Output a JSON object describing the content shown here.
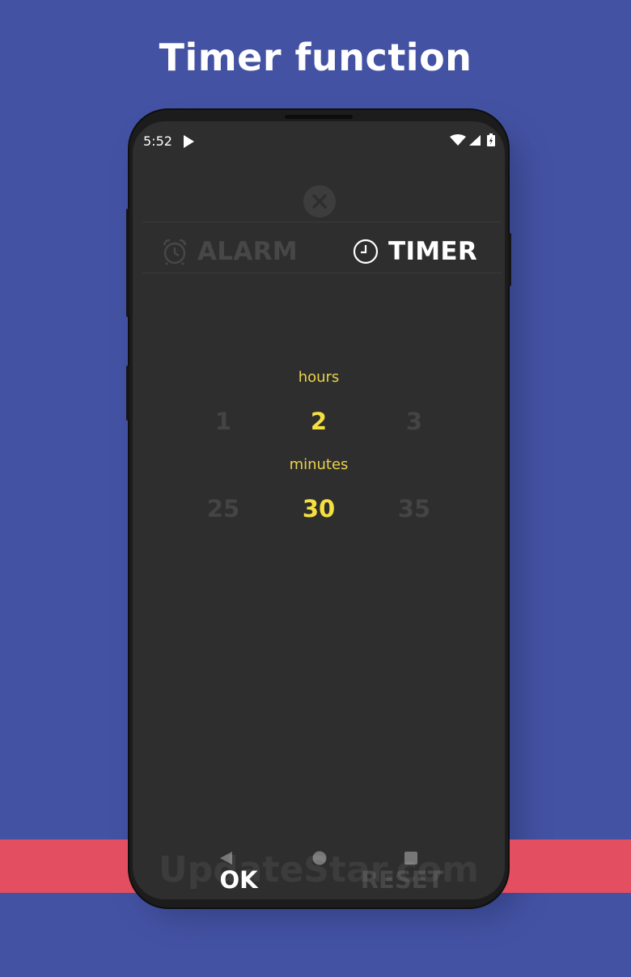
{
  "headline": "Timer function",
  "status_bar": {
    "time": "5:52",
    "icons": [
      "play-icon",
      "wifi-icon",
      "signal-icon",
      "battery-icon"
    ]
  },
  "tabs": [
    {
      "label": "ALARM",
      "icon": "alarm-clock-icon",
      "active": false
    },
    {
      "label": "TIMER",
      "icon": "clock-icon",
      "active": true
    }
  ],
  "hours": {
    "label": "hours",
    "options": [
      "1",
      "2",
      "3"
    ],
    "selected": "2"
  },
  "minutes": {
    "label": "minutes",
    "options": [
      "25",
      "30",
      "35"
    ],
    "selected": "30"
  },
  "buttons": {
    "ok": "OK",
    "reset": "RESET"
  },
  "watermark": "UpdateStar.com",
  "colors": {
    "background": "#4352a3",
    "band": "#e34f61",
    "screen": "#2e2e2e",
    "accent": "#f5e040",
    "dim": "#444444"
  }
}
